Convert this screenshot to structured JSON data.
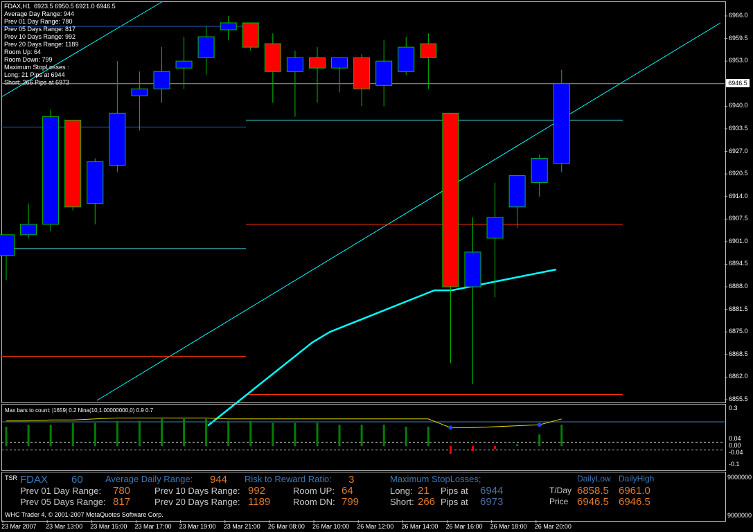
{
  "header": {
    "symbol_timeframe": "FDAX,H1",
    "ohlc": "6923.5 6950.5 6921.0 6946.5"
  },
  "info_panel": [
    "Average Day  Range: 944",
    "Prev 01  Day  Range: 780",
    "Prev 05  Days Range: 817",
    "Prev 10  Days Range: 992",
    "Prev 20  Days Range: 1189",
    "Room Up:      64",
    "Room Down: 799",
    "Maximum StopLosses :",
    "Long:  21 Pips at 6944",
    "Short: 266 Pips at 6973"
  ],
  "price_axis": {
    "ticks": [
      "6966.0",
      "6959.5",
      "6953.0",
      "6940.0",
      "6933.5",
      "6927.0",
      "6920.5",
      "6914.0",
      "6907.5",
      "6901.0",
      "6894.5",
      "6888.0",
      "6881.5",
      "6875.0",
      "6868.5",
      "6862.0",
      "6855.5"
    ],
    "current_price": "6946.5"
  },
  "osc": {
    "title": "Max bars to count: |1659|  0.2  Nina(10,1.00000000,0)  0.9  0.7",
    "ticks": [
      "0.3",
      "0.04",
      "0.00",
      "-0.04",
      "-0.1"
    ]
  },
  "right_axis_ticks": [
    "9000000",
    "9000000"
  ],
  "time_axis": [
    "23 Mar 2007",
    "23 Mar 13:00",
    "23 Mar 15:00",
    "23 Mar 17:00",
    "23 Mar 19:00",
    "23 Mar 21:00",
    "26 Mar 08:00",
    "26 Mar 10:00",
    "26 Mar 12:00",
    "26 Mar 14:00",
    "26 Mar 16:00",
    "26 Mar 18:00",
    "26 Mar 20:00"
  ],
  "tsr": {
    "tag": "TSR",
    "symbol": "FDAX",
    "period": "60",
    "avg_daily_range_label": "Average Daily Range:",
    "avg_daily_range": "944",
    "rr_label": "Risk to Reward Ratio:",
    "rr": "3",
    "max_sl_label": "Maximum StopLosses;",
    "daily_low_label": "DailyLow",
    "daily_high_label": "DailyHigh",
    "prev01_label": "Prev 01 Day Range:",
    "prev01": "780",
    "prev10_label": "Prev 10 Days Range:",
    "prev10": "992",
    "room_up_label": "Room UP:",
    "room_up": "64",
    "long_label": "Long:",
    "long_pips": "21",
    "pips_at_label": "Pips at",
    "long_price": "6944",
    "tday_label": "T/Day",
    "tday_low": "6858.5",
    "tday_high": "6961.0",
    "prev05_label": "Prev 05 Days Range:",
    "prev05": "817",
    "prev20_label": "Prev 20 Days Range:",
    "prev20": "1189",
    "room_dn_label": "Room DN:",
    "room_dn": "799",
    "short_label": "Short:",
    "short_pips": "266",
    "short_price": "6973",
    "price_label": "Price",
    "price_low": "6946.5",
    "price_high": "6946.5",
    "copyright": "WHC Trader 4, © 2001-2007 MetaQuotes Software Corp."
  },
  "colors": {
    "bull": "#0000ff",
    "bear": "#ff0000",
    "wick": "#00c000",
    "aqua": "#00ffff",
    "level_blue": "#2060c0",
    "level_red": "#ff3000",
    "level_cyan": "#40d0d0",
    "hist_green": "#008000",
    "hist_red": "#ff0000",
    "osc_yellow": "#e0e000"
  },
  "chart_data": {
    "type": "candlestick",
    "symbol": "FDAX",
    "timeframe": "H1",
    "candles": [
      {
        "o": 6897,
        "h": 6903,
        "l": 6890,
        "c": 6903
      },
      {
        "o": 6903,
        "h": 6912,
        "l": 6902,
        "c": 6906
      },
      {
        "o": 6906,
        "h": 6939,
        "l": 6904,
        "c": 6937
      },
      {
        "o": 6936,
        "h": 6936,
        "l": 6910,
        "c": 6911
      },
      {
        "o": 6912,
        "h": 6925,
        "l": 6906,
        "c": 6924
      },
      {
        "o": 6923,
        "h": 6953,
        "l": 6921,
        "c": 6938
      },
      {
        "o": 6943,
        "h": 6950,
        "l": 6933,
        "c": 6945
      },
      {
        "o": 6945,
        "h": 6957,
        "l": 6941,
        "c": 6950
      },
      {
        "o": 6951,
        "h": 6960,
        "l": 6945,
        "c": 6953
      },
      {
        "o": 6954,
        "h": 6963,
        "l": 6949,
        "c": 6960
      },
      {
        "o": 6962,
        "h": 6966,
        "l": 6959,
        "c": 6964
      },
      {
        "o": 6964,
        "h": 6964,
        "l": 6956,
        "c": 6957
      },
      {
        "o": 6958,
        "h": 6961,
        "l": 6941,
        "c": 6950
      },
      {
        "o": 6950,
        "h": 6956,
        "l": 6937,
        "c": 6954
      },
      {
        "o": 6954,
        "h": 6957,
        "l": 6941,
        "c": 6951
      },
      {
        "o": 6951,
        "h": 6953,
        "l": 6944,
        "c": 6954
      },
      {
        "o": 6954,
        "h": 6955,
        "l": 6940,
        "c": 6945
      },
      {
        "o": 6946,
        "h": 6959,
        "l": 6940,
        "c": 6953
      },
      {
        "o": 6950,
        "h": 6960,
        "l": 6949,
        "c": 6957
      },
      {
        "o": 6958,
        "h": 6961,
        "l": 6945,
        "c": 6954
      },
      {
        "o": 6938,
        "h": 6938,
        "l": 6866,
        "c": 6888
      },
      {
        "o": 6888,
        "h": 6908,
        "l": 6860,
        "c": 6898
      },
      {
        "o": 6902,
        "h": 6918,
        "l": 6885,
        "c": 6908
      },
      {
        "o": 6911,
        "h": 6920,
        "l": 6905,
        "c": 6920
      },
      {
        "o": 6918,
        "h": 6926,
        "l": 6914,
        "c": 6925
      },
      {
        "o": 6923.5,
        "h": 6950.5,
        "l": 6921,
        "c": 6946.5
      }
    ],
    "levels": [
      {
        "price": 6963,
        "color": "blue"
      },
      {
        "price": 6934,
        "color": "blue"
      },
      {
        "price": 6899,
        "color": "cyan"
      },
      {
        "price": 6868,
        "color": "red"
      },
      {
        "price": 6946.5,
        "color": "gray"
      },
      {
        "price": 6936,
        "color": "cyan"
      },
      {
        "price": 6906,
        "color": "red"
      },
      {
        "price": 6857,
        "color": "red"
      }
    ],
    "moving_average": [
      6848,
      6852,
      6856,
      6860,
      6864,
      6868,
      6872,
      6875,
      6877,
      6879,
      6881,
      6883,
      6885,
      6887,
      6887,
      6888,
      6889,
      6890,
      6891,
      6892,
      6893
    ],
    "oscillator": {
      "bars": [
        0.2,
        0.22,
        0.22,
        0.24,
        0.24,
        0.26,
        0.26,
        0.28,
        0.28,
        0.28,
        0.26,
        0.26,
        0.24,
        0.24,
        0.24,
        0.22,
        0.22,
        0.22,
        0.2,
        0.2,
        -0.08,
        -0.05,
        -0.03,
        0.02,
        0.12,
        0.22
      ],
      "signal": [
        0.26,
        0.26,
        0.27,
        0.27,
        0.28,
        0.29,
        0.29,
        0.29,
        0.29,
        0.29,
        0.28,
        0.28,
        0.28,
        0.28,
        0.28,
        0.28,
        0.28,
        0.28,
        0.28,
        0.28,
        0.19,
        0.19,
        0.2,
        0.21,
        0.22,
        0.28
      ]
    }
  }
}
